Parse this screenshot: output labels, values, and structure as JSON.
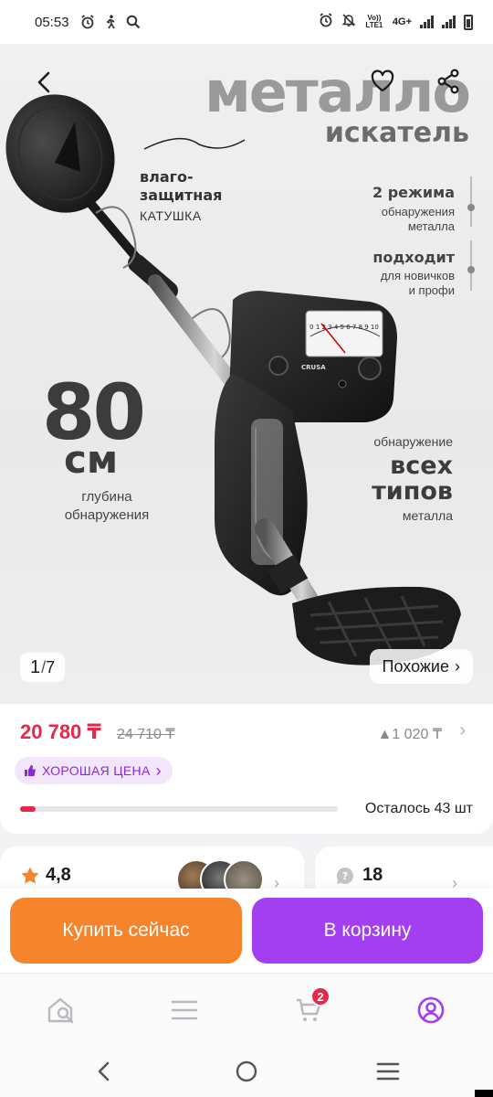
{
  "status_bar": {
    "time": "05:53",
    "volte_label": "Vo)) LTE1",
    "network": "4G+"
  },
  "gallery": {
    "title_main": "металло",
    "title_sub": "искатель",
    "coil_label_bold": "влаго-\nзащитная",
    "coil_label_small": "КАТУШКА",
    "mode_bold": "2 режима",
    "mode_small": "обнаружения\nметалла",
    "fit_bold": "подходит",
    "fit_small": "для новичков\nи профи",
    "depth_number": "80",
    "depth_unit": "см",
    "depth_label": "глубина\nобнаружения",
    "detect_line1": "обнаружение",
    "detect_line2": "всех\nтипов",
    "detect_line3": "металла",
    "dial_text": "0 1 2 3 4 5 6 7 8 9 10",
    "brand_text": "CRUSA",
    "page_current": "1",
    "page_total": "7",
    "similar_label": "Похожие",
    "similar_chevron": "›"
  },
  "price": {
    "current": "20 780 ₸",
    "old": "24 710 ₸",
    "diff": "▲1 020 ₸",
    "badge": "ХОРОШАЯ ЦЕНА",
    "badge_chevron": "›",
    "stock_text": "Осталось 43 шт",
    "stock_fill_fraction": 0.05
  },
  "rating": {
    "value": "4,8",
    "reviews_count": "18"
  },
  "actions": {
    "buy_now": "Купить сейчас",
    "add_to_cart": "В корзину"
  },
  "bottom_nav": {
    "items": [
      "search-home-icon",
      "catalog-icon",
      "cart-icon",
      "profile-icon"
    ],
    "cart_badge": "2"
  },
  "colors": {
    "price_red": "#e8284b",
    "accent_purple": "#a43ff1",
    "buy_orange": "#f6842d"
  }
}
